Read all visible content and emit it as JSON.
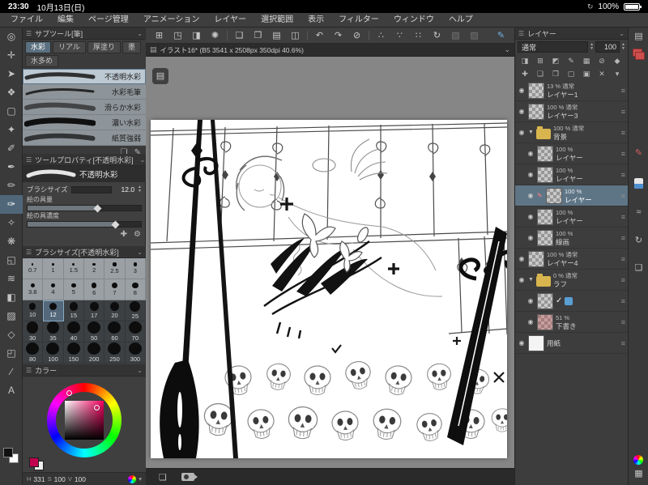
{
  "status_bar": {
    "time": "23:30",
    "date": "10月13日(日)",
    "battery_percent": "100%",
    "sync_glyph": "↻"
  },
  "menu_bar": {
    "items": [
      "ファイル",
      "編集",
      "ページ管理",
      "アニメーション",
      "レイヤー",
      "選択範囲",
      "表示",
      "フィルター",
      "ウィンドウ",
      "ヘルプ"
    ]
  },
  "tool_strip": {
    "tools": [
      {
        "name": "zoom-tool",
        "glyph": "◎"
      },
      {
        "name": "move-tool",
        "glyph": "✛"
      },
      {
        "name": "operation-tool",
        "glyph": "➤"
      },
      {
        "name": "layer-move-tool",
        "glyph": "❖"
      },
      {
        "name": "selection-tool",
        "glyph": "▢"
      },
      {
        "name": "auto-select-tool",
        "glyph": "✦"
      },
      {
        "name": "eyedropper-tool",
        "glyph": "✐"
      },
      {
        "name": "pen-tool",
        "glyph": "✒"
      },
      {
        "name": "pencil-tool",
        "glyph": "✏"
      },
      {
        "name": "brush-tool",
        "glyph": "✑"
      },
      {
        "name": "airbrush-tool",
        "glyph": "✧"
      },
      {
        "name": "decoration-tool",
        "glyph": "❋"
      },
      {
        "name": "eraser-tool",
        "glyph": "◱"
      },
      {
        "name": "blend-tool",
        "glyph": "≋"
      },
      {
        "name": "fill-tool",
        "glyph": "◧"
      },
      {
        "name": "gradient-tool",
        "glyph": "▨"
      },
      {
        "name": "figure-tool",
        "glyph": "◇"
      },
      {
        "name": "frame-tool",
        "glyph": "◰"
      },
      {
        "name": "ruler-tool",
        "glyph": "∕"
      },
      {
        "name": "text-tool",
        "glyph": "A"
      }
    ]
  },
  "toolbar": {
    "icons": [
      {
        "name": "workspace-grid-icon",
        "glyph": "⊞"
      },
      {
        "name": "export-icon",
        "glyph": "◳"
      },
      {
        "name": "display-icon",
        "glyph": "◨"
      },
      {
        "name": "clip-logo-icon",
        "glyph": "✺"
      },
      {
        "name": "new-page-icon",
        "glyph": "❏"
      },
      {
        "name": "duplicate-page-icon",
        "glyph": "❐"
      },
      {
        "name": "page-list-icon",
        "glyph": "▤"
      },
      {
        "name": "panel-icon",
        "glyph": "◫"
      },
      {
        "name": "undo-icon",
        "glyph": "↶"
      },
      {
        "name": "redo-icon",
        "glyph": "↷"
      },
      {
        "name": "clear-icon",
        "glyph": "⊘"
      },
      {
        "name": "snap-1-icon",
        "glyph": "∴"
      },
      {
        "name": "snap-2-icon",
        "glyph": "∵"
      },
      {
        "name": "snap-3-icon",
        "glyph": "∷"
      },
      {
        "name": "rotate-icon",
        "glyph": "↻"
      },
      {
        "name": "select-op-1-icon",
        "glyph": "▧"
      },
      {
        "name": "select-op-2-icon",
        "glyph": "▨"
      },
      {
        "name": "pen-pressure-icon",
        "glyph": "✎"
      }
    ]
  },
  "subtool_panel": {
    "title": "サブツール[筆]",
    "tabs": [
      "水彩",
      "リアル",
      "厚塗り",
      "墨",
      "水多め"
    ],
    "items": [
      "不透明水彩",
      "水彩毛筆",
      "滑らか水彩",
      "濃い水彩",
      "紙質強弱"
    ]
  },
  "tool_property_panel": {
    "title": "ツールプロパティ[不透明水彩]",
    "tool_name": "不透明水彩",
    "brush_size_label": "ブラシサイズ",
    "brush_size_value": "12.0",
    "slider1_label": "絵の具量",
    "slider2_label": "絵の具濃度"
  },
  "brush_size_panel": {
    "title": "ブラシサイズ[不透明水彩]",
    "selected": "12",
    "rows": [
      [
        "0.7",
        "1",
        "1.5",
        "2",
        "2.5",
        "3"
      ],
      [
        "3.8",
        "4",
        "5",
        "6",
        "7",
        "8"
      ],
      [
        "10",
        "12",
        "15",
        "17",
        "20",
        "25"
      ],
      [
        "30",
        "35",
        "40",
        "50",
        "60",
        "70"
      ],
      [
        "80",
        "100",
        "150",
        "200",
        "250",
        "300"
      ]
    ]
  },
  "color_panel": {
    "title": "カラー",
    "h_label": "H",
    "h": "331",
    "s_label": "S",
    "s": "100",
    "v_label": "V",
    "v": "100",
    "current_color": "#c2004f"
  },
  "canvas": {
    "tab_title": "イラスト16* (B5 3541 x 2508px 350dpi 40.6%)"
  },
  "layer_panel": {
    "title": "レイヤー",
    "blend_mode": "通常",
    "opacity": "100",
    "layers": [
      {
        "info": "13 % 通常",
        "name": "レイヤー1"
      },
      {
        "info": "100 % 通常",
        "name": "レイヤー3"
      },
      {
        "info": "100 % 通常",
        "name": "背景"
      },
      {
        "info": "100 %",
        "name": "レイヤー"
      },
      {
        "info": "100 %",
        "name": "レイヤー"
      },
      {
        "info": "100 %",
        "name": "レイヤー"
      },
      {
        "info": "100 %",
        "name": "レイヤー"
      },
      {
        "info": "100 %",
        "name": "線画"
      },
      {
        "info": "100 % 通常",
        "name": "レイヤー4"
      },
      {
        "info": "0 % 通常",
        "name": "ラフ"
      },
      {
        "info": "",
        "name": ""
      },
      {
        "info": "51 %",
        "name": "下書き"
      },
      {
        "info": "",
        "name": "用紙"
      }
    ]
  },
  "dock": {
    "workspace_glyph": "▤",
    "pen_glyph": "✎",
    "stroke_glyph": "≈",
    "sync_glyph": "↻",
    "page_glyph": "❏",
    "grid_glyph": "▦"
  },
  "canvas_bottom": {
    "pages_glyph": "❏"
  }
}
